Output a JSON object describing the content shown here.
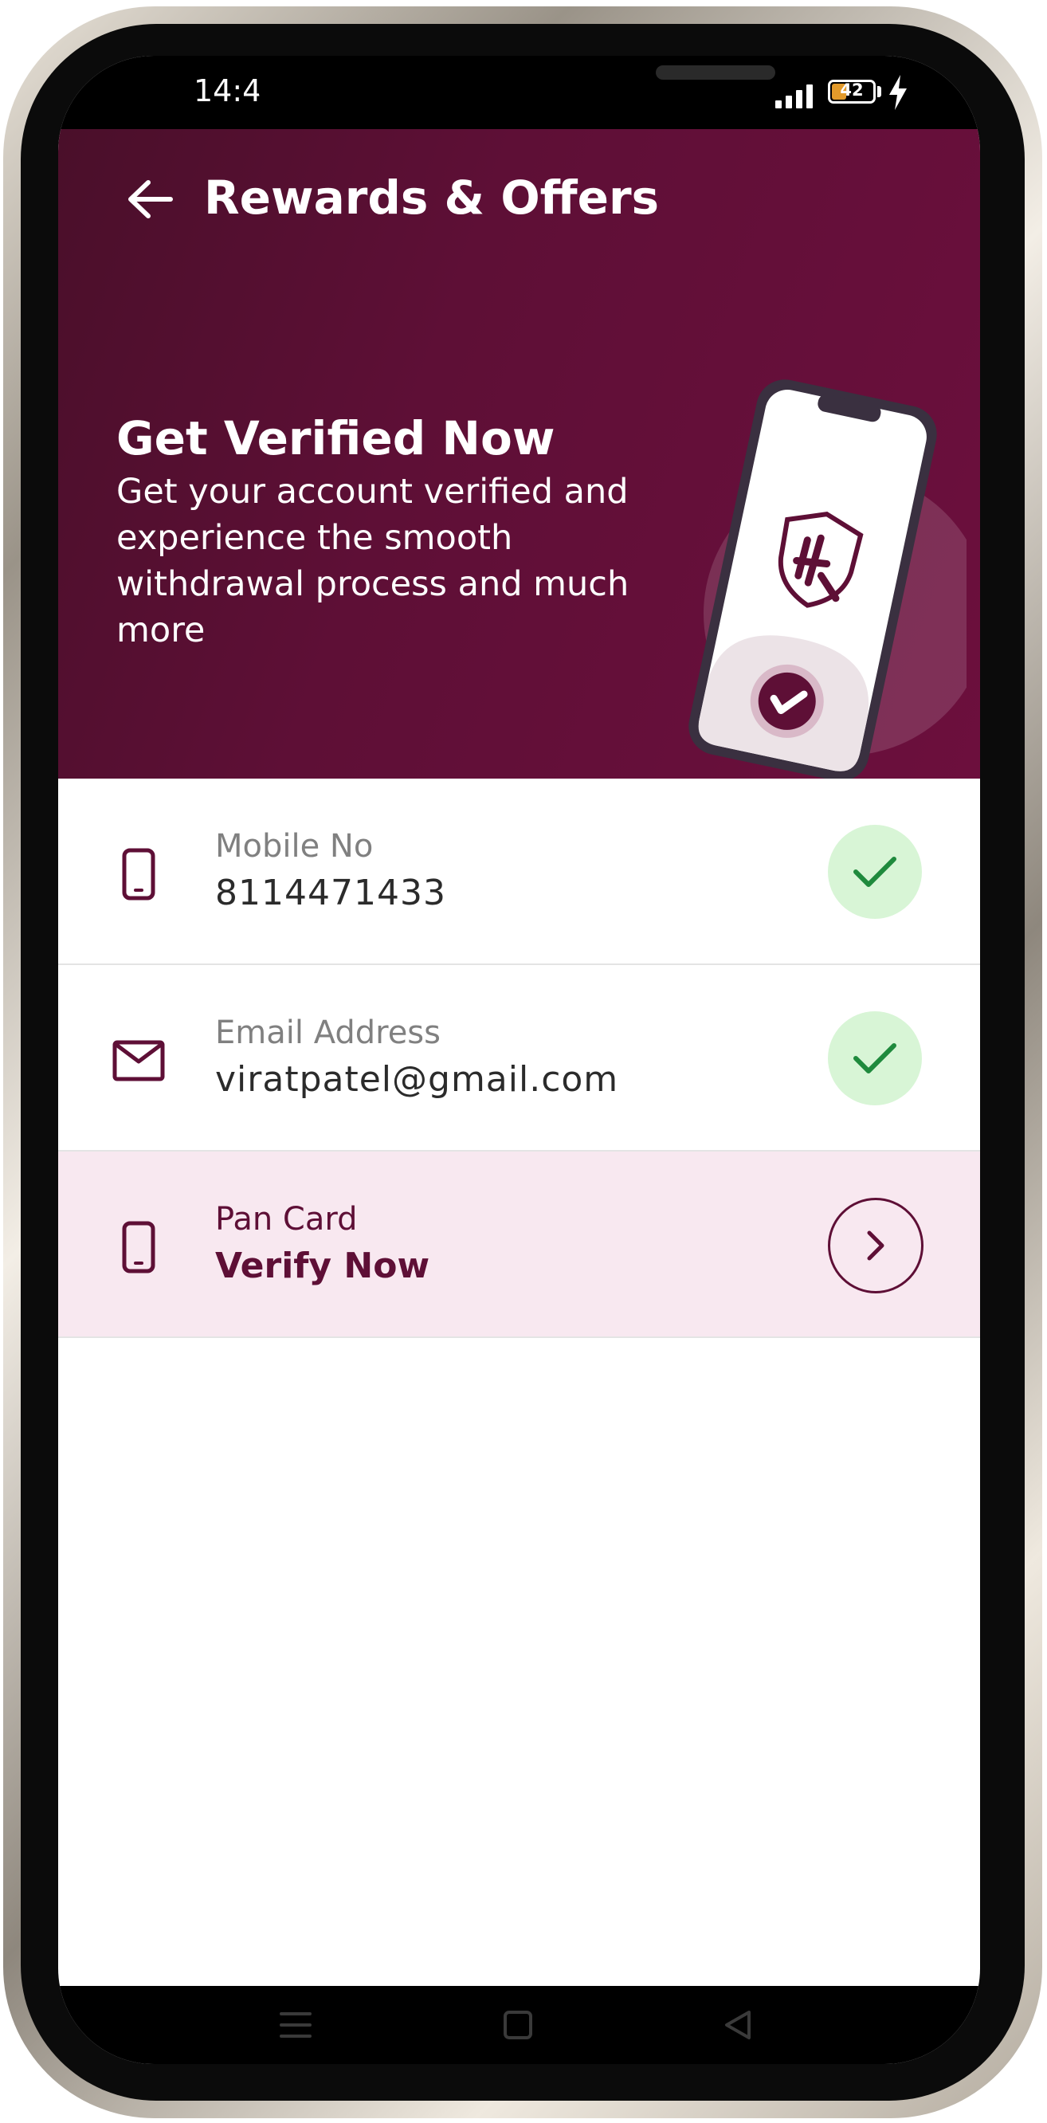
{
  "status_bar": {
    "time": "14:4",
    "battery": "42"
  },
  "header": {
    "title": "Rewards & Offers"
  },
  "hero": {
    "title": "Get Verified Now",
    "description": "Get your account verified and experience the smooth withdrawal process and much more"
  },
  "verification": {
    "items": [
      {
        "label": "Mobile No",
        "value": "8114471433",
        "status": "verified",
        "icon": "mobile-icon"
      },
      {
        "label": "Email Address",
        "value": "viratpatel@gmail.com",
        "status": "verified",
        "icon": "mail-icon"
      },
      {
        "label": "Pan Card",
        "value": "Verify Now",
        "status": "pending",
        "icon": "mobile-icon"
      }
    ]
  },
  "colors": {
    "brand": "#5e0f36",
    "verified_bg": "#d8f5d6",
    "verified_check": "#1f8a3d",
    "pending_bg": "#f8e8f0"
  }
}
